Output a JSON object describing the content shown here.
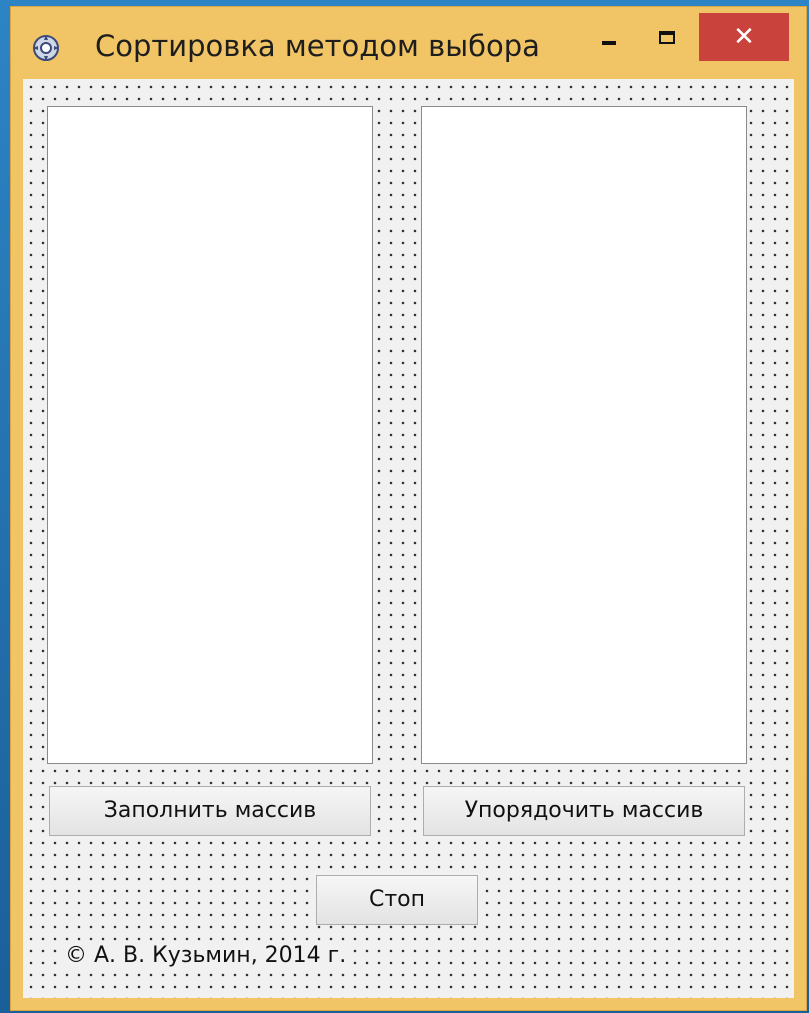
{
  "window": {
    "title": "Сортировка методом выбора",
    "app_icon": "gear-flower-icon",
    "controls": {
      "minimize_icon": "minimize-icon",
      "maximize_icon": "maximize-icon",
      "close_label": "✕"
    },
    "accent_color": "#f1c565",
    "close_color": "#c9423b"
  },
  "form": {
    "list_left": {
      "items": []
    },
    "list_right": {
      "items": []
    },
    "buttons": {
      "fill_label": "Заполнить массив",
      "sort_label": "Упорядочить массив",
      "stop_label": "Стоп"
    },
    "copyright": "© А. В. Кузьмин, 2014 г."
  }
}
